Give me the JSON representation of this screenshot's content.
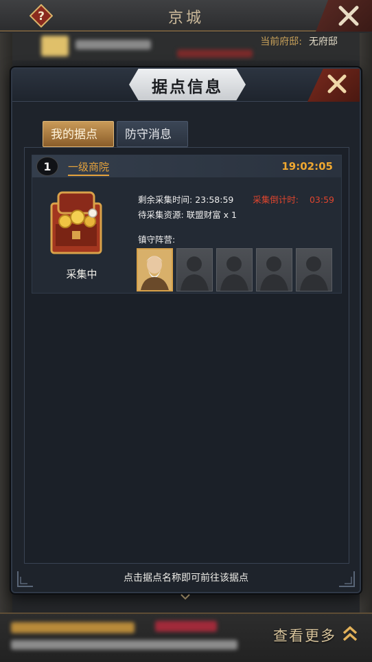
{
  "top_bar": {
    "title": "京城",
    "help_icon": "question-diamond-icon",
    "close_icon": "close-x-icon"
  },
  "mansion": {
    "label": "当前府邸:",
    "value": "无府邸"
  },
  "dialog": {
    "title": "据点信息",
    "close_icon": "close-x-icon",
    "tabs": [
      {
        "label": "我的据点",
        "active": true
      },
      {
        "label": "防守消息",
        "active": false
      }
    ],
    "card": {
      "level": "1",
      "name": "一级商院",
      "time": "19:02:05",
      "status": "采集中",
      "remain_label": "剩余采集时间:",
      "remain_value": "23:58:59",
      "countdown_label": "采集倒计时:",
      "countdown_value": "03:59",
      "pending_label": "待采集资源:",
      "pending_value": "联盟财富 x 1",
      "guard_label": "镇守阵营:",
      "guard_slots": [
        "occupied",
        "empty",
        "empty",
        "empty",
        "empty"
      ],
      "icon": "treasure-chest-icon"
    },
    "footer_hint": "点击据点名称即可前往该据点"
  },
  "bottom_bar": {
    "view_more": "查看更多",
    "arrows_icon": "double-chevron-up-icon"
  },
  "colors": {
    "gold": "#e6a33c",
    "red": "#e0452e",
    "panel": "#1e232b"
  }
}
